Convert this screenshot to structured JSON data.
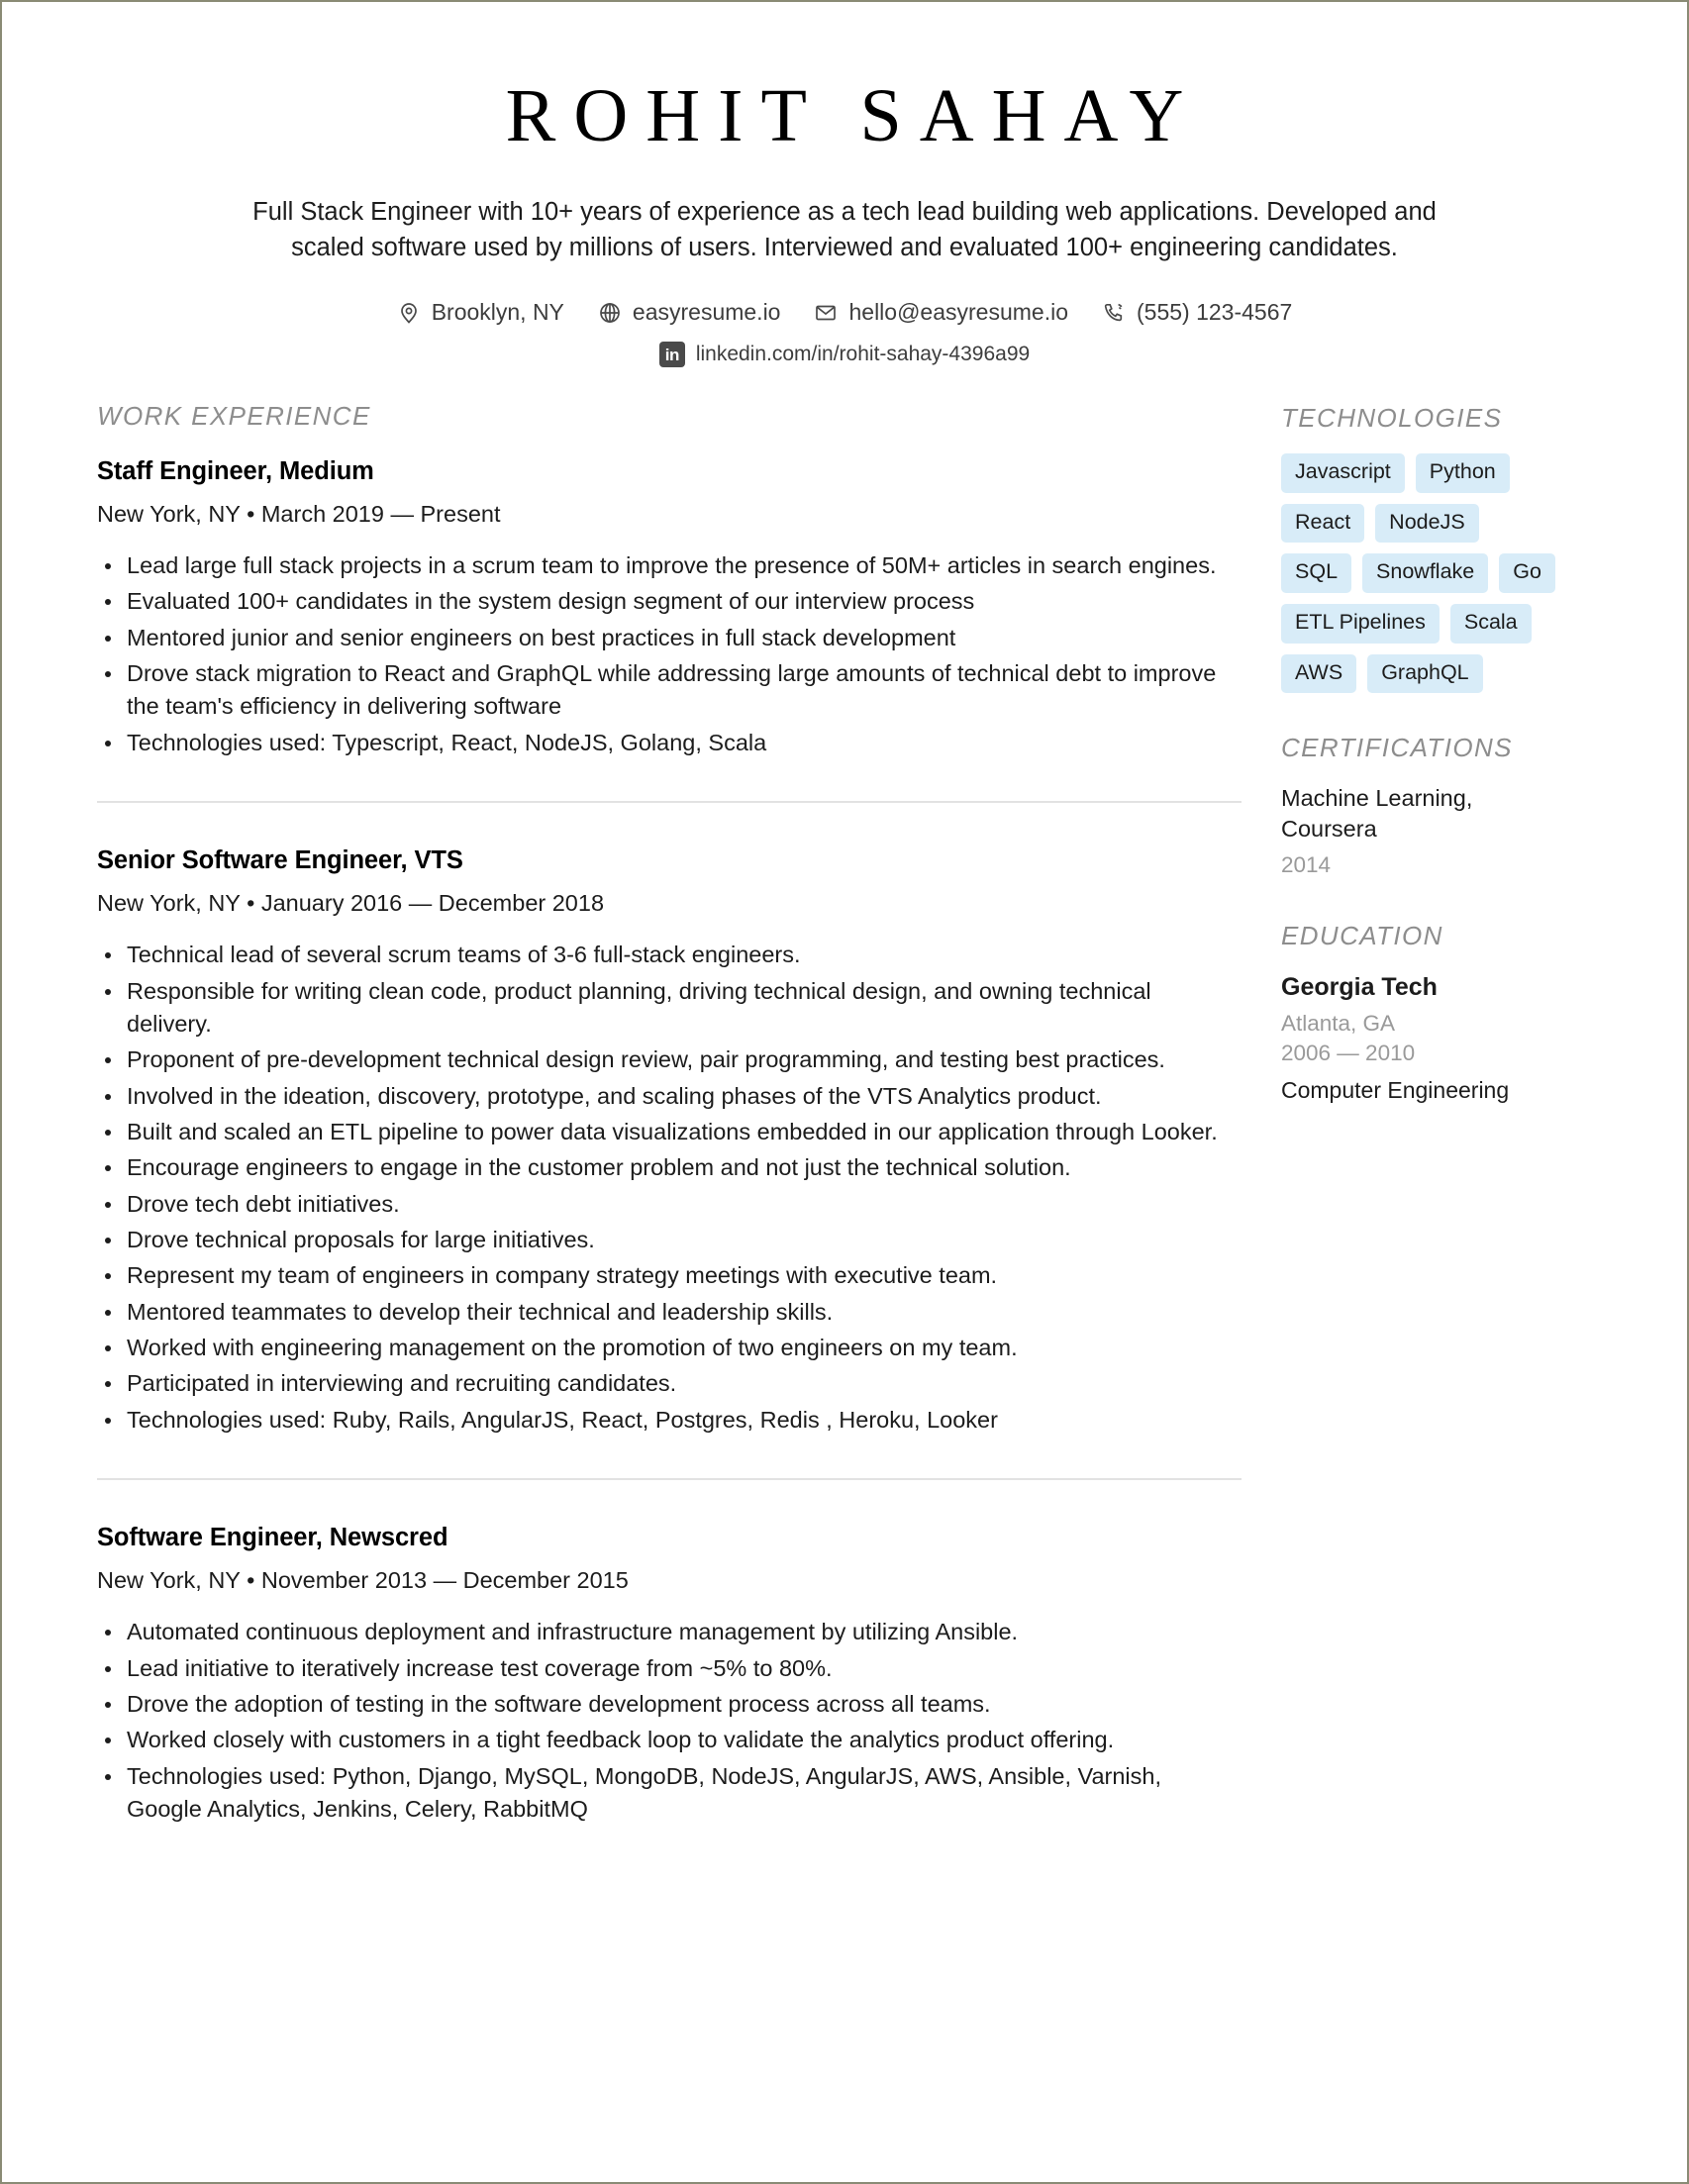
{
  "header": {
    "name": "ROHIT SAHAY",
    "summary": "Full Stack Engineer with 10+ years of experience as a tech lead building web applications. Developed and scaled software used by millions of users. Interviewed and evaluated 100+ engineering candidates.",
    "contacts": [
      {
        "icon": "map-pin-icon",
        "text": "Brooklyn, NY"
      },
      {
        "icon": "globe-icon",
        "text": "easyresume.io"
      },
      {
        "icon": "envelope-icon",
        "text": "hello@easyresume.io"
      },
      {
        "icon": "phone-icon",
        "text": "(555) 123-4567"
      }
    ],
    "linkedin": {
      "icon": "linkedin-icon",
      "badge_text": "in",
      "text": "linkedin.com/in/rohit-sahay-4396a99"
    }
  },
  "main": {
    "section_title": "WORK EXPERIENCE",
    "jobs": [
      {
        "title": "Staff Engineer, Medium",
        "meta": "New York, NY • March 2019 — Present",
        "bullets": [
          "Lead large full stack projects in a scrum team to improve the presence of 50M+ articles in search engines.",
          "Evaluated 100+ candidates in the system design segment of our interview process",
          "Mentored junior and senior engineers on best practices in full stack development",
          "Drove stack migration to React and GraphQL while addressing large amounts of technical debt to improve the team's efficiency in delivering software",
          "Technologies used: Typescript, React, NodeJS, Golang, Scala"
        ]
      },
      {
        "title": "Senior Software Engineer, VTS",
        "meta": "New York, NY • January 2016 — December 2018",
        "bullets": [
          "Technical lead of several scrum teams of 3-6 full-stack engineers.",
          "Responsible for writing clean code, product planning, driving technical design, and owning technical delivery.",
          "Proponent of pre-development technical design review, pair programming, and testing best practices.",
          "Involved in the ideation, discovery, prototype, and scaling phases of the VTS Analytics product.",
          "Built and scaled an ETL pipeline to power data visualizations embedded in our application through Looker.",
          "Encourage engineers to engage in the customer problem and not just the technical solution.",
          "Drove tech debt initiatives.",
          "Drove technical proposals for large initiatives.",
          "Represent my team of engineers in company strategy meetings with executive team.",
          "Mentored teammates to develop their technical and leadership skills.",
          "Worked with engineering management on the promotion of two engineers on my team.",
          "Participated in interviewing and recruiting candidates.",
          "Technologies used: Ruby, Rails, AngularJS, React, Postgres, Redis , Heroku, Looker"
        ]
      },
      {
        "title": "Software Engineer, Newscred",
        "meta": "New York, NY • November 2013 — December 2015",
        "bullets": [
          "Automated continuous deployment and infrastructure management by utilizing Ansible.",
          "Lead initiative to iteratively increase test coverage from ~5% to 80%.",
          "Drove the adoption of testing in the software development process across all teams.",
          "Worked closely with customers in a tight feedback loop to validate the analytics product offering.",
          "Technologies used: Python, Django, MySQL, MongoDB, NodeJS, AngularJS, AWS, Ansible, Varnish, Google Analytics, Jenkins, Celery, RabbitMQ"
        ]
      }
    ]
  },
  "sidebar": {
    "technologies": {
      "title": "TECHNOLOGIES",
      "tags": [
        "Javascript",
        "Python",
        "React",
        "NodeJS",
        "SQL",
        "Snowflake",
        "Go",
        "ETL Pipelines",
        "Scala",
        "AWS",
        "GraphQL"
      ]
    },
    "certifications": {
      "title": "CERTIFICATIONS",
      "name": "Machine Learning, Coursera",
      "year": "2014"
    },
    "education": {
      "title": "EDUCATION",
      "school": "Georgia Tech",
      "location": "Atlanta, GA",
      "years": "2006 — 2010",
      "degree": "Computer Engineering"
    }
  },
  "colors": {
    "tag_background": "#d8ecf8",
    "section_heading": "#8d8d8d",
    "muted_text": "#9a9a9a",
    "divider": "#e2e2e2",
    "page_border": "#8a8b75"
  }
}
